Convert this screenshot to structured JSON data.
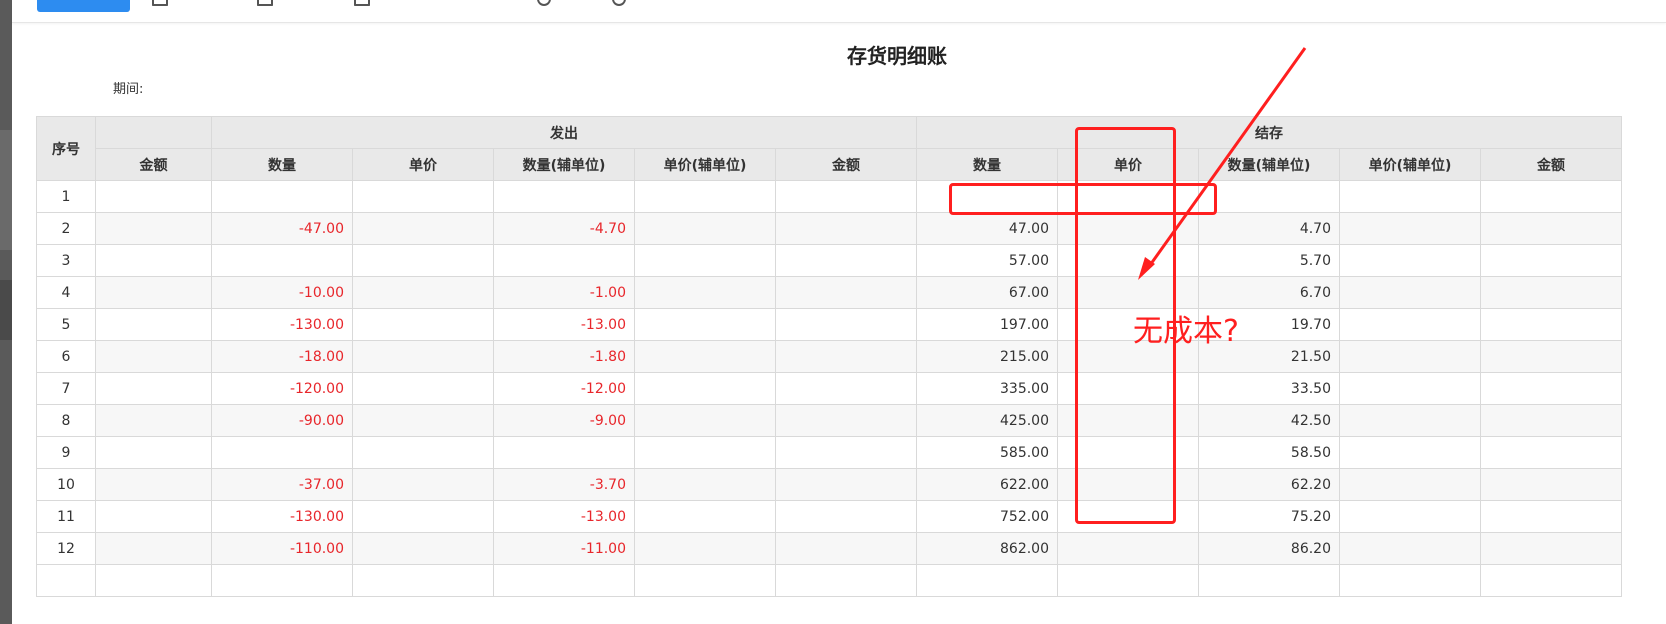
{
  "report": {
    "title": "存货明细账",
    "period_label": "期间:"
  },
  "table": {
    "seq_header": "序号",
    "group_headers": {
      "issue": "发出",
      "balance": "结存"
    },
    "column_headers": [
      "金额",
      "数量",
      "单价",
      "数量(辅单位)",
      "单价(辅单位)",
      "金额",
      "数量",
      "单价",
      "数量(辅单位)",
      "单价(辅单位)",
      "金额"
    ],
    "rows": [
      {
        "seq": "1",
        "issue_qty": "",
        "issue_aux_qty": "",
        "bal_qty": "",
        "bal_aux_qty": ""
      },
      {
        "seq": "2",
        "issue_qty": "-47.00",
        "issue_aux_qty": "-4.70",
        "bal_qty": "47.00",
        "bal_aux_qty": "4.70"
      },
      {
        "seq": "3",
        "issue_qty": "",
        "issue_aux_qty": "",
        "bal_qty": "57.00",
        "bal_aux_qty": "5.70"
      },
      {
        "seq": "4",
        "issue_qty": "-10.00",
        "issue_aux_qty": "-1.00",
        "bal_qty": "67.00",
        "bal_aux_qty": "6.70"
      },
      {
        "seq": "5",
        "issue_qty": "-130.00",
        "issue_aux_qty": "-13.00",
        "bal_qty": "197.00",
        "bal_aux_qty": "19.70"
      },
      {
        "seq": "6",
        "issue_qty": "-18.00",
        "issue_aux_qty": "-1.80",
        "bal_qty": "215.00",
        "bal_aux_qty": "21.50"
      },
      {
        "seq": "7",
        "issue_qty": "-120.00",
        "issue_aux_qty": "-12.00",
        "bal_qty": "335.00",
        "bal_aux_qty": "33.50"
      },
      {
        "seq": "8",
        "issue_qty": "-90.00",
        "issue_aux_qty": "-9.00",
        "bal_qty": "425.00",
        "bal_aux_qty": "42.50"
      },
      {
        "seq": "9",
        "issue_qty": "",
        "issue_aux_qty": "",
        "bal_qty": "585.00",
        "bal_aux_qty": "58.50"
      },
      {
        "seq": "10",
        "issue_qty": "-37.00",
        "issue_aux_qty": "-3.70",
        "bal_qty": "622.00",
        "bal_aux_qty": "62.20"
      },
      {
        "seq": "11",
        "issue_qty": "-130.00",
        "issue_aux_qty": "-13.00",
        "bal_qty": "752.00",
        "bal_aux_qty": "75.20"
      },
      {
        "seq": "12",
        "issue_qty": "-110.00",
        "issue_aux_qty": "-11.00",
        "bal_qty": "862.00",
        "bal_aux_qty": "86.20"
      },
      {
        "seq": "",
        "issue_qty": "",
        "issue_aux_qty": "",
        "bal_qty": "",
        "bal_aux_qty": ""
      }
    ]
  },
  "annotation": {
    "text": "无成本?",
    "color": "#ff1f1f"
  },
  "colors": {
    "negative": "#e8262b",
    "header_bg": "#e9e9e9",
    "primary_button": "#2d8cf0"
  }
}
